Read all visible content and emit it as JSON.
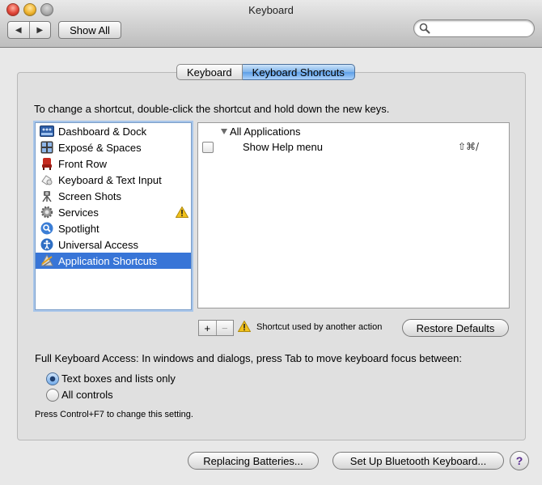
{
  "window": {
    "title": "Keyboard"
  },
  "toolbar": {
    "back_glyph": "◀",
    "forward_glyph": "▶",
    "show_all_label": "Show All",
    "search_value": "",
    "search_placeholder": ""
  },
  "tabs": [
    {
      "label": "Keyboard",
      "selected": false
    },
    {
      "label": "Keyboard Shortcuts",
      "selected": true
    }
  ],
  "instruction": "To change a shortcut, double-click the shortcut and hold down the new keys.",
  "categories": [
    {
      "label": "Dashboard & Dock",
      "icon": "dashboard-dock-icon",
      "selected": false,
      "warning": false
    },
    {
      "label": "Exposé & Spaces",
      "icon": "expose-spaces-icon",
      "selected": false,
      "warning": false
    },
    {
      "label": "Front Row",
      "icon": "front-row-icon",
      "selected": false,
      "warning": false
    },
    {
      "label": "Keyboard & Text Input",
      "icon": "keyboard-text-input-icon",
      "selected": false,
      "warning": false
    },
    {
      "label": "Screen Shots",
      "icon": "screen-shots-icon",
      "selected": false,
      "warning": false
    },
    {
      "label": "Services",
      "icon": "services-gear-icon",
      "selected": false,
      "warning": true
    },
    {
      "label": "Spotlight",
      "icon": "spotlight-icon",
      "selected": false,
      "warning": false
    },
    {
      "label": "Universal Access",
      "icon": "universal-access-icon",
      "selected": false,
      "warning": false
    },
    {
      "label": "Application Shortcuts",
      "icon": "application-shortcuts-icon",
      "selected": true,
      "warning": false
    }
  ],
  "shortcuts": {
    "group_label": "All Applications",
    "items": [
      {
        "label": "Show Help menu",
        "keys": "⇧⌘/",
        "checked": false
      }
    ]
  },
  "list_controls": {
    "add_label": "+",
    "remove_label": "−"
  },
  "legend": {
    "text": "Shortcut used by another action"
  },
  "restore_label": "Restore Defaults",
  "full_keyboard_access": {
    "text": "Full Keyboard Access: In windows and dialogs, press Tab to move keyboard focus between:",
    "options": [
      {
        "label": "Text boxes and lists only",
        "selected": true
      },
      {
        "label": "All controls",
        "selected": false
      }
    ],
    "note": "Press Control+F7 to change this setting."
  },
  "bottom_buttons": {
    "replacing_batteries_label": "Replacing Batteries...",
    "bluetooth_label": "Set Up Bluetooth Keyboard...",
    "help_label": "?"
  },
  "colors": {
    "selection": "#3875d7",
    "window_bg": "#e8e8e8",
    "warning": "#f2c21b"
  }
}
